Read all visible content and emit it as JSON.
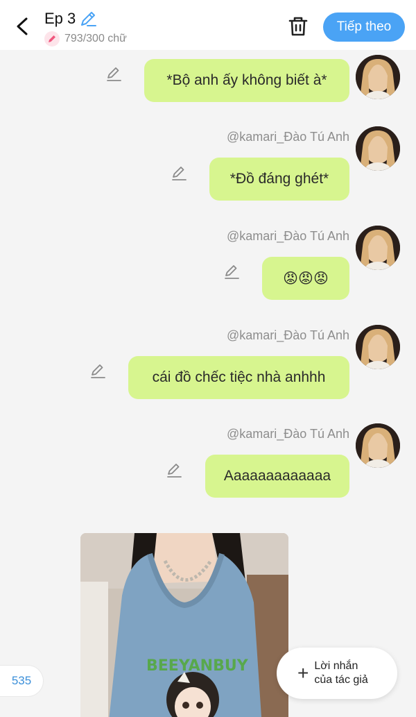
{
  "header": {
    "title": "Ep 3",
    "word_count": "793/300 chữ",
    "next_label": "Tiếp theo"
  },
  "messages": [
    {
      "text": "*Bộ anh ấy không biết à*"
    },
    {
      "username": "@kamari_Đào Tú Anh",
      "text": "*Đồ đáng ghét*"
    },
    {
      "username": "@kamari_Đào Tú Anh",
      "text": "😡😡😡"
    },
    {
      "username": "@kamari_Đào Tú Anh",
      "text": "cái đồ chếc tiệc nhà anhhh"
    },
    {
      "username": "@kamari_Đào Tú Anh",
      "text": "Aaaaaaaaaaaaa"
    }
  ],
  "photo": {
    "shirt_text": "BEEYANBUY"
  },
  "footer": {
    "count": "535",
    "author_note_line1": "Lời nhắn",
    "author_note_line2": "của tác giả"
  },
  "colors": {
    "bubble": "#d7f58f",
    "accent": "#4aa3f5",
    "background": "#f4f4f4"
  },
  "icons": [
    "back-arrow-icon",
    "pencil-icon",
    "trash-icon",
    "avatar",
    "plus-icon"
  ]
}
